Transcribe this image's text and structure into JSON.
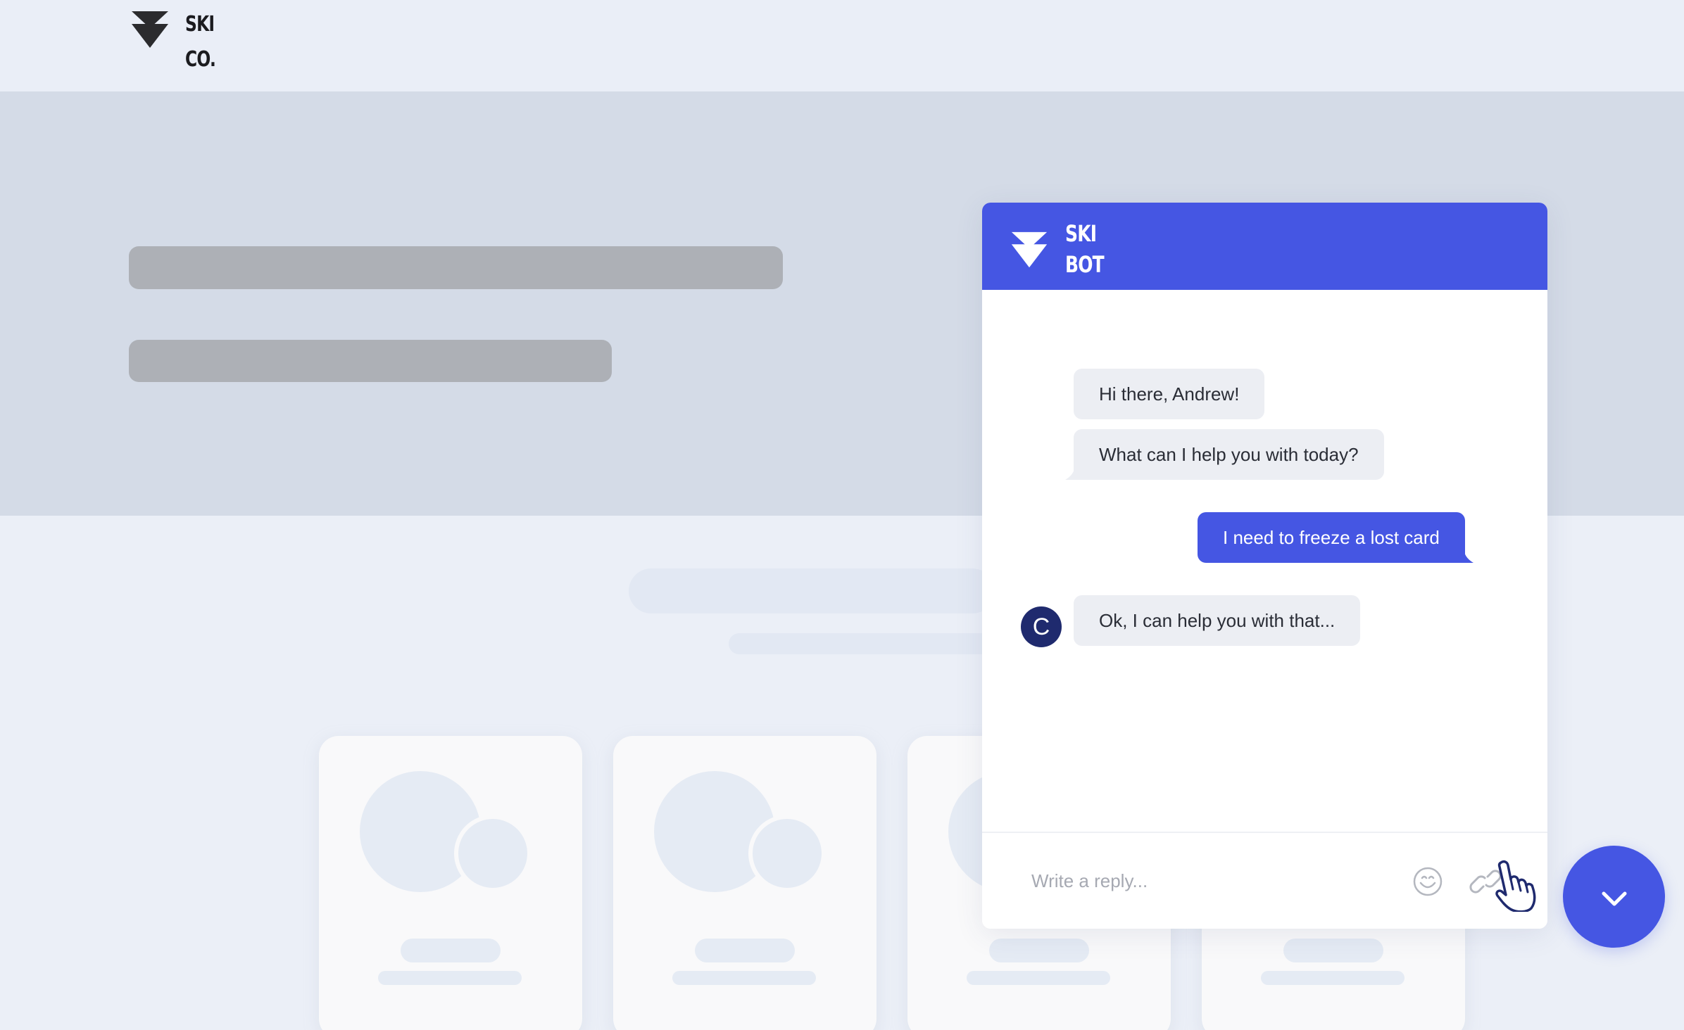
{
  "site": {
    "logo_line1": "SKI",
    "logo_line2": "CO."
  },
  "chat": {
    "header": {
      "title_line1": "SKI",
      "title_line2": "BOT"
    },
    "messages": [
      {
        "from": "bot",
        "text": "Hi there, Andrew!"
      },
      {
        "from": "bot",
        "text": "What can I help you with today?"
      },
      {
        "from": "user",
        "text": "I need to freeze a lost card"
      },
      {
        "from": "bot",
        "text": "Ok, I can help you with that..."
      }
    ],
    "avatar_initial": "C",
    "composer": {
      "placeholder": "Write a reply...",
      "emoji_icon": "emoji-smile-icon",
      "attach_icon": "link-attach-icon"
    },
    "collapse_icon": "chevron-down-icon"
  },
  "colors": {
    "brand": "#4556e3",
    "avatar": "#1f2a6e",
    "bot_bubble": "#eceef3",
    "hero_bg": "#d4dbe7",
    "page_bg": "#ebeff7"
  }
}
